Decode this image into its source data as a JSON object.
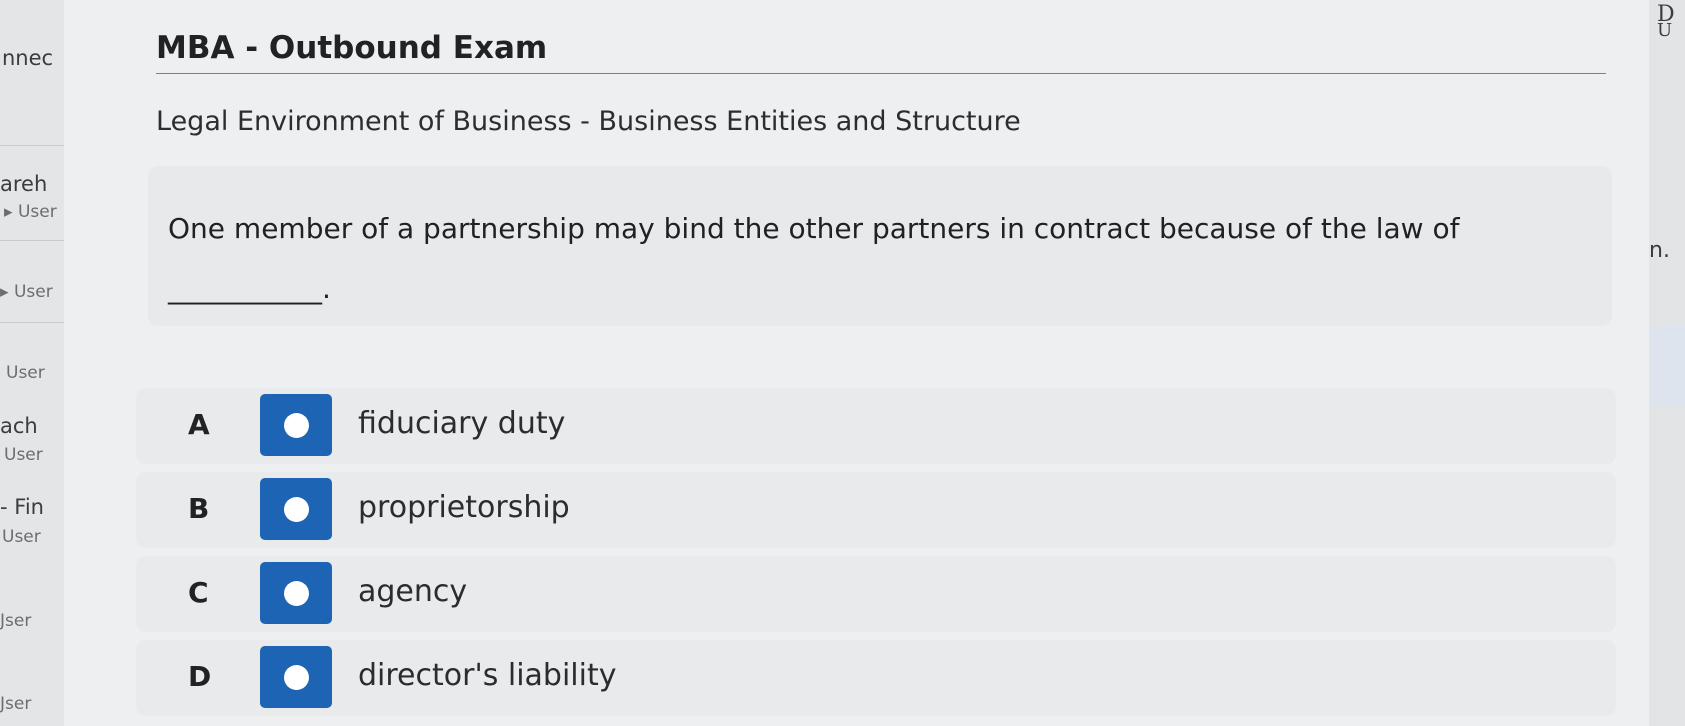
{
  "sidebar": {
    "fragments": [
      "nnec",
      "areh",
      "User",
      "User",
      "User",
      "ach",
      "User",
      "Fin",
      "User",
      "Jser",
      "Jser"
    ]
  },
  "exam": {
    "title": "MBA - Outbound Exam",
    "subtitle": "Legal Environment of Business - Business Entities and Structure",
    "question": "One member of a partnership may bind the other partners in contract because of the law of",
    "blank": "___________.",
    "options": [
      {
        "letter": "A",
        "label": "fiduciary duty"
      },
      {
        "letter": "B",
        "label": "proprietorship"
      },
      {
        "letter": "C",
        "label": "agency"
      },
      {
        "letter": "D",
        "label": "director's liability"
      }
    ]
  },
  "right_panel": {
    "top_letters": [
      "D",
      "U"
    ],
    "fragment": "n."
  },
  "colors": {
    "radio_fill": "#1e64b4",
    "panel_bg": "#eeeff0"
  }
}
